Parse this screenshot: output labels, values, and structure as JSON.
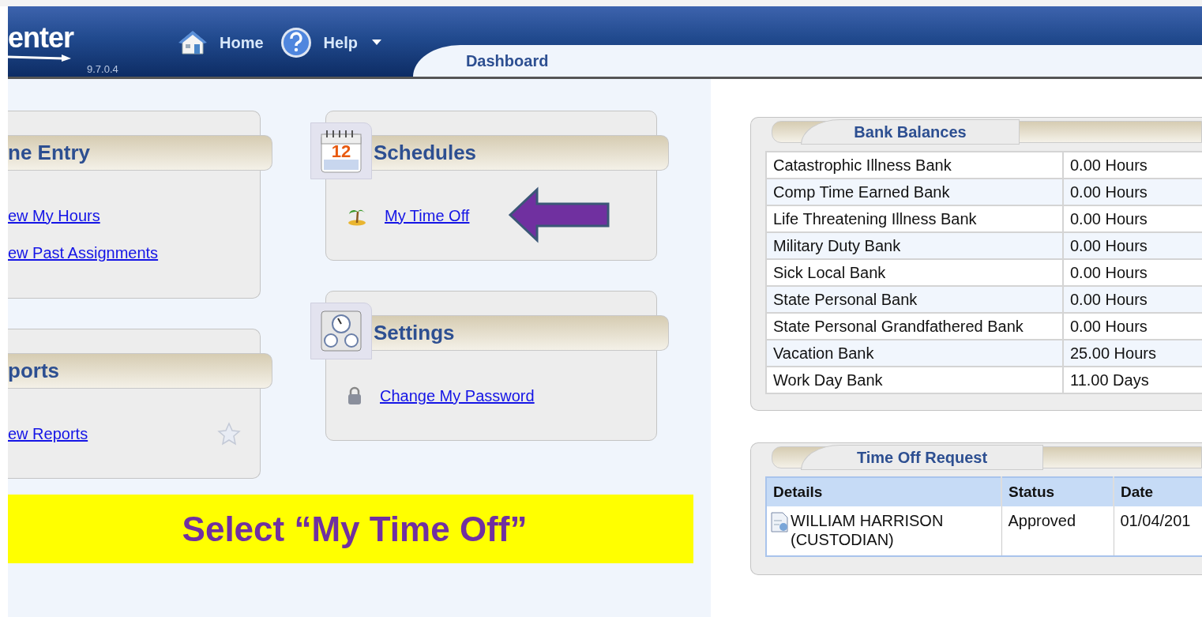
{
  "header": {
    "logo_text": "enter",
    "version": "9.7.0.4",
    "nav": [
      {
        "label": "Home",
        "dropdown": false
      },
      {
        "label": "Help",
        "dropdown": true
      }
    ],
    "tabs": [
      {
        "label": "Dashboard",
        "selected": true
      }
    ]
  },
  "left_panels": [
    {
      "title": "ne Entry",
      "links": [
        {
          "label": "ew My Hours"
        },
        {
          "label": "ew Past Assignments"
        }
      ]
    },
    {
      "title": "ports",
      "links": [
        {
          "label": "ew Reports"
        }
      ]
    }
  ],
  "middle_panels": [
    {
      "title": "Schedules",
      "icon_text": "12",
      "links": [
        {
          "label": "My Time Off"
        }
      ]
    },
    {
      "title": "Settings",
      "links": [
        {
          "label": "Change My Password"
        }
      ]
    }
  ],
  "callout": {
    "text": "Select “My Time Off”"
  },
  "bank_balances": {
    "title": "Bank Balances",
    "rows": [
      {
        "bank": "Catastrophic Illness Bank",
        "balance": "0.00 Hours"
      },
      {
        "bank": "Comp Time Earned Bank",
        "balance": "0.00 Hours"
      },
      {
        "bank": "Life Threatening Illness Bank",
        "balance": "0.00 Hours"
      },
      {
        "bank": "Military Duty Bank",
        "balance": "0.00 Hours"
      },
      {
        "bank": "Sick Local Bank",
        "balance": "0.00 Hours"
      },
      {
        "bank": "State Personal Bank",
        "balance": "0.00 Hours"
      },
      {
        "bank": "State Personal Grandfathered Bank",
        "balance": "0.00 Hours"
      },
      {
        "bank": "Vacation Bank",
        "balance": "25.00 Hours"
      },
      {
        "bank": "Work Day Bank",
        "balance": "11.00 Days"
      }
    ]
  },
  "time_off_request": {
    "title": "Time Off Request",
    "columns": [
      "Details",
      "Status",
      "Date"
    ],
    "rows": [
      {
        "details": "WILLIAM HARRISON (CUSTODIAN)",
        "status": "Approved",
        "date": "01/04/201"
      }
    ]
  }
}
